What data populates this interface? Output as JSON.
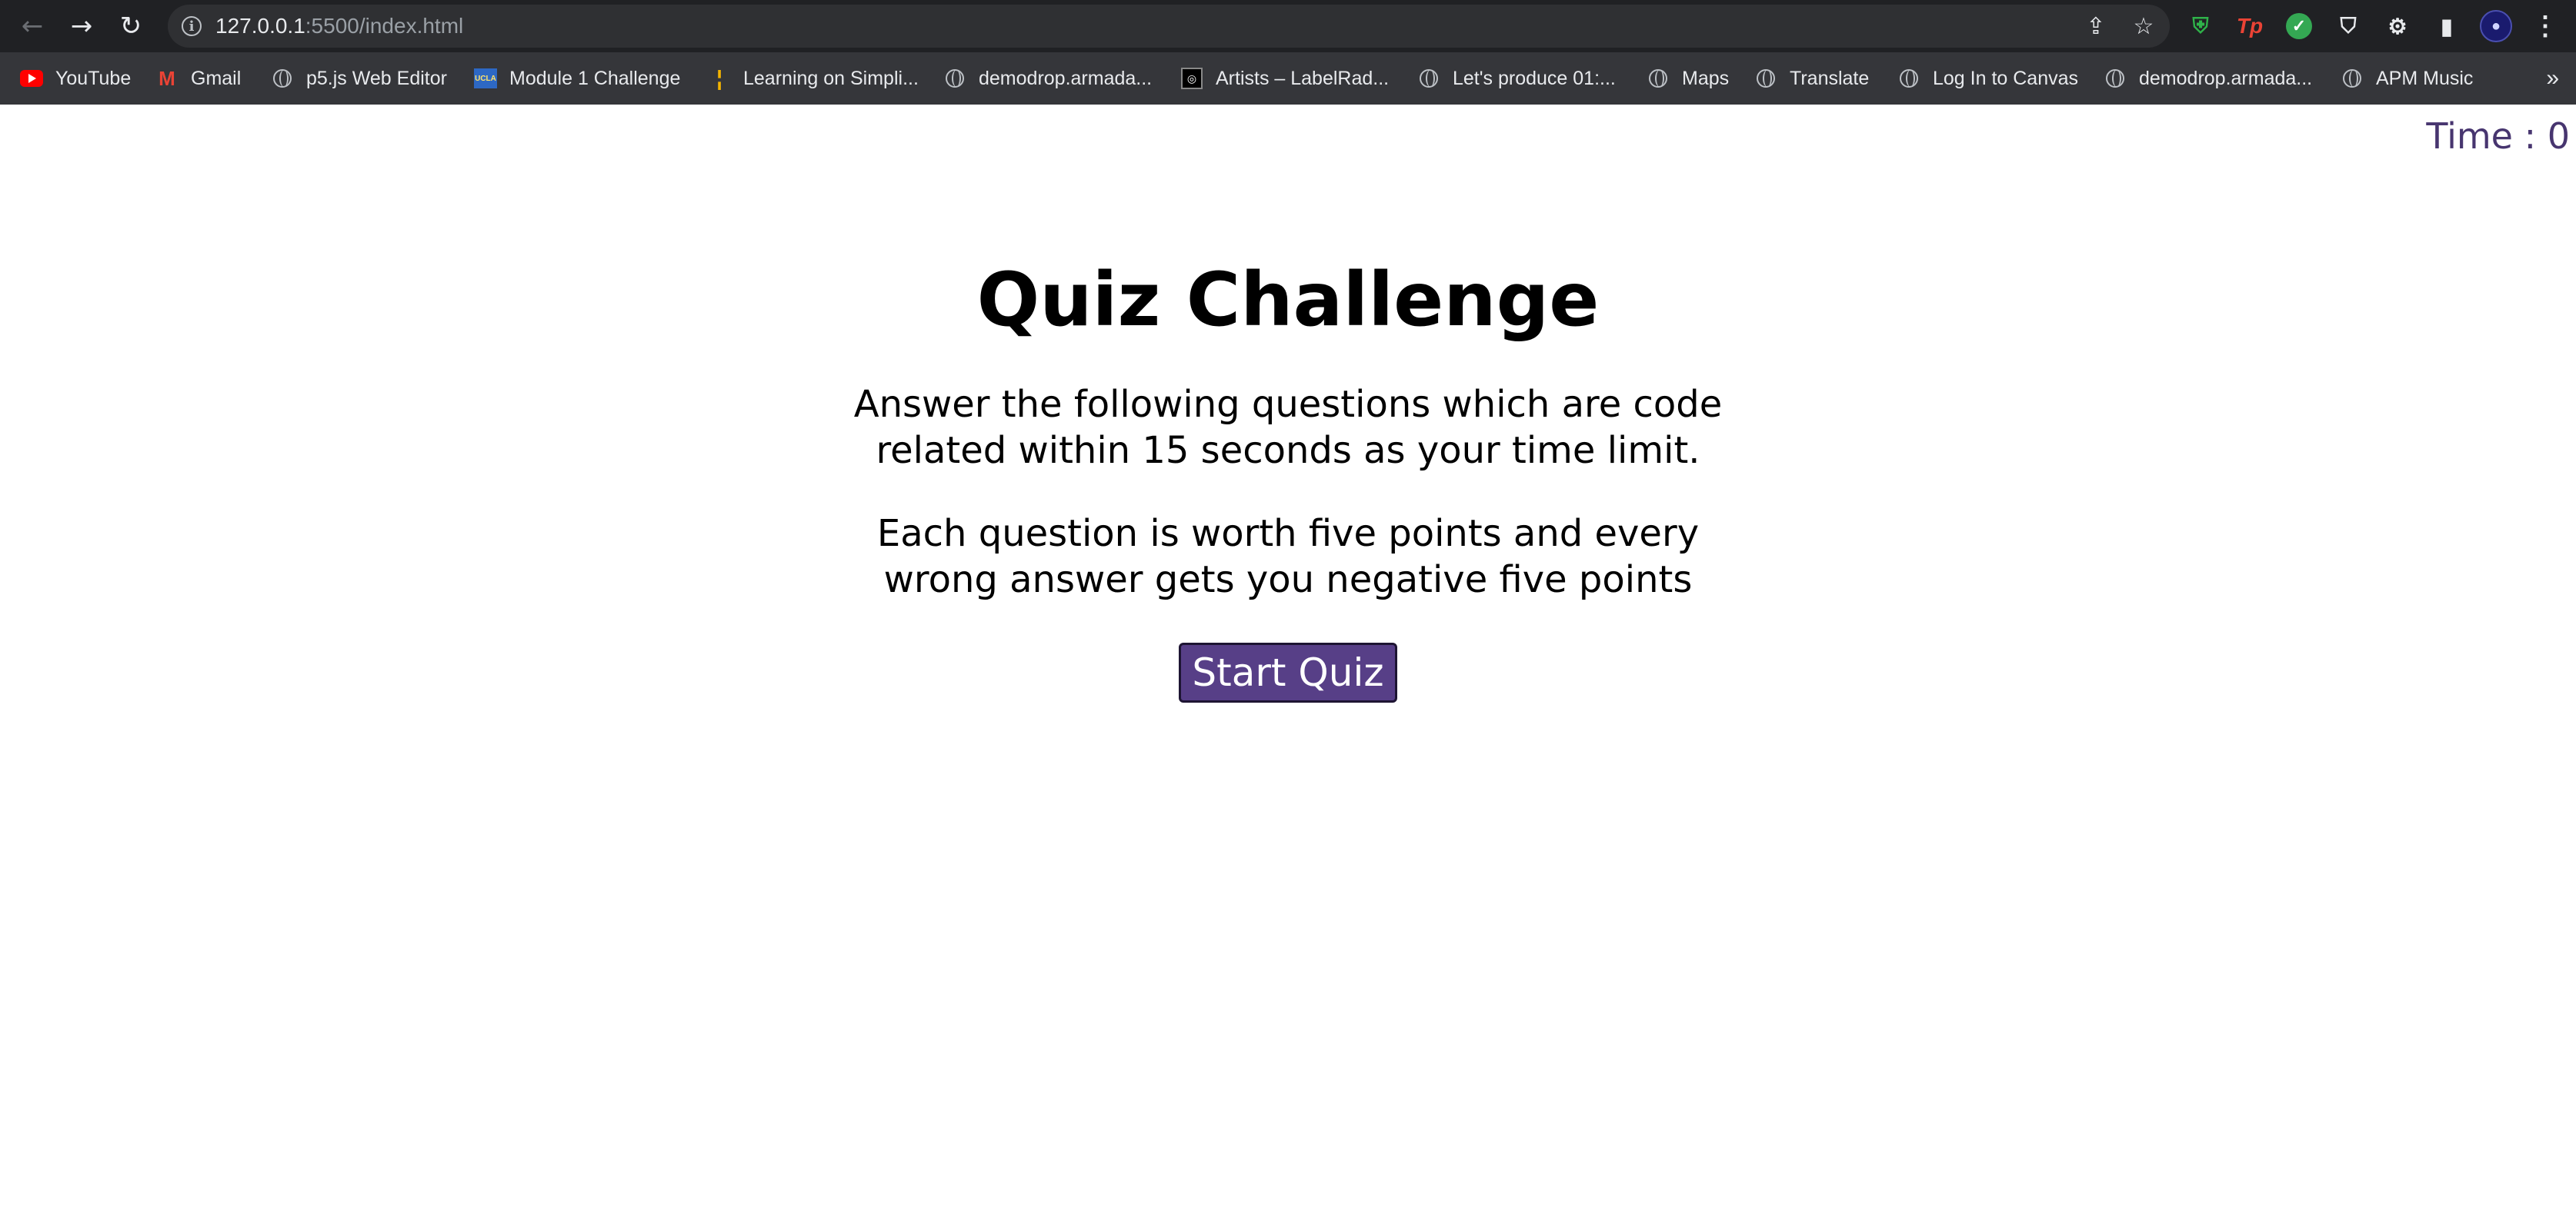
{
  "browser": {
    "url_host": "127.0.0.1",
    "url_rest": ":5500/index.html",
    "bookmarks": [
      {
        "label": "YouTube",
        "icon": "youtube-icon"
      },
      {
        "label": "Gmail",
        "icon": "gmail-icon"
      },
      {
        "label": "p5.js Web Editor",
        "icon": "globe-icon"
      },
      {
        "label": "Module 1 Challenge",
        "icon": "ucla-icon"
      },
      {
        "label": "Learning on Simpli...",
        "icon": "simplilearn-icon"
      },
      {
        "label": "demodrop.armada...",
        "icon": "globe-icon"
      },
      {
        "label": "Artists – LabelRad...",
        "icon": "labelradar-icon"
      },
      {
        "label": "Let's produce 01:...",
        "icon": "globe-icon"
      },
      {
        "label": "Maps",
        "icon": "globe-icon"
      },
      {
        "label": "Translate",
        "icon": "globe-icon"
      },
      {
        "label": "Log In to Canvas",
        "icon": "globe-icon"
      },
      {
        "label": "demodrop.armada...",
        "icon": "globe-icon"
      },
      {
        "label": "APM Music",
        "icon": "globe-icon"
      }
    ]
  },
  "page": {
    "timer": "Time : 0",
    "title": "Quiz Challenge",
    "paragraph1": "Answer the following questions which are code related within 15 seconds as your time limit.",
    "paragraph2": "Each question is worth five points and every wrong answer gets you negative five points",
    "start_button": "Start Quiz"
  },
  "colors": {
    "accent": "#573f87",
    "timer": "#47356f"
  }
}
